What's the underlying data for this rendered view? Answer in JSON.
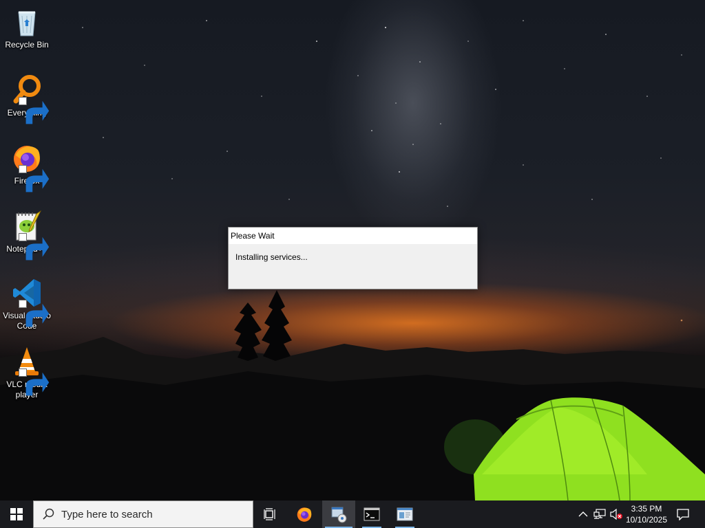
{
  "desktop": {
    "icons": [
      {
        "label": "Recycle Bin",
        "icon": "recycle-bin-icon",
        "shortcut": false
      },
      {
        "label": "Everything",
        "icon": "everything-search-icon",
        "shortcut": true
      },
      {
        "label": "Firefox",
        "icon": "firefox-icon",
        "shortcut": true
      },
      {
        "label": "Notepad++",
        "icon": "notepad-plus-plus-icon",
        "shortcut": true
      },
      {
        "label": "Visual Studio Code",
        "icon": "vscode-icon",
        "shortcut": true
      },
      {
        "label": "VLC media player",
        "icon": "vlc-icon",
        "shortcut": true
      }
    ]
  },
  "dialog": {
    "title": "Please Wait",
    "message": "Installing services..."
  },
  "taskbar": {
    "start_icon": "windows-logo-icon",
    "search": {
      "placeholder": "Type here to search",
      "icon": "search-icon"
    },
    "buttons": [
      {
        "name": "task-view",
        "icon": "task-view-icon"
      },
      {
        "name": "firefox",
        "icon": "firefox-icon"
      },
      {
        "name": "installer",
        "icon": "installer-icon",
        "active": true
      },
      {
        "name": "command-prompt",
        "icon": "command-prompt-icon",
        "running": true
      },
      {
        "name": "window-app",
        "icon": "window-app-icon",
        "running": true
      }
    ],
    "tray": {
      "overflow_icon": "chevron-up-icon",
      "network_icon": "network-icon",
      "volume_icon": "volume-muted-icon",
      "notifications_icon": "notification-icon"
    },
    "clock": {
      "time": "3:35 PM",
      "date": "10/10/2025"
    }
  },
  "colors": {
    "taskbar_bg": "#1a1b1f",
    "active_underline": "#7fb8ea",
    "dialog_bg": "#f0f0f0",
    "tent_green": "#8fe020"
  }
}
